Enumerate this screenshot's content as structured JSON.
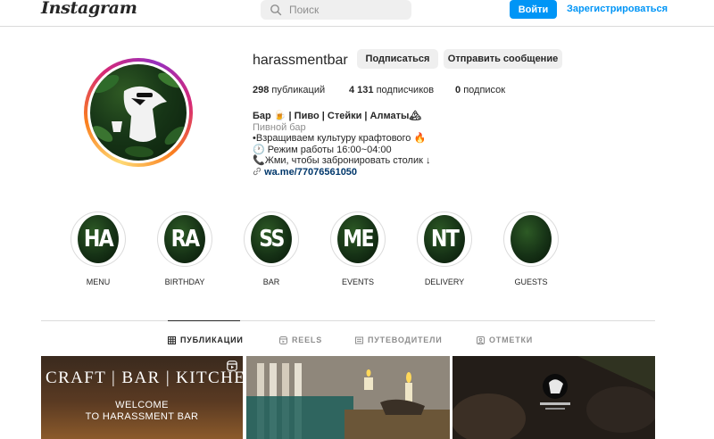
{
  "header": {
    "logo": "Instagram",
    "search_placeholder": "Поиск",
    "login_label": "Войти",
    "register_label": "Зарегистрироваться",
    "accent_color": "#0095f6"
  },
  "profile": {
    "username": "harassmentbar",
    "follow_label": "Подписаться",
    "message_label": "Отправить сообщение",
    "posts_count": "298",
    "posts_label": "публикаций",
    "followers_count": "4 131",
    "followers_label": "подписчиков",
    "following_count": "0",
    "following_label": "подписок",
    "bio_name": "Бар 🍺 | Пиво | Стейки | Алматы🏔",
    "bio_category": "Пивной бар",
    "bio_line1": "•Взращиваем культуру крафтового 🔥",
    "bio_line2": "🕐 Режим работы 16:00~04:00",
    "bio_line3": "📞Жми, чтобы забронировать столик ↓",
    "bio_link": "wa.me/77076561050"
  },
  "highlights": [
    {
      "label": "MENU",
      "letters": "HA"
    },
    {
      "label": "BIRTHDAY",
      "letters": "RA"
    },
    {
      "label": "BAR",
      "letters": "SS"
    },
    {
      "label": "EVENTS",
      "letters": "ME"
    },
    {
      "label": "DELIVERY",
      "letters": "NT"
    },
    {
      "label": "GUESTS",
      "letters": ""
    }
  ],
  "tabs": [
    {
      "label": "ПУБЛИКАЦИИ",
      "icon": "grid-icon",
      "active": true
    },
    {
      "label": "REELS",
      "icon": "reels-icon",
      "active": false
    },
    {
      "label": "ПУТЕВОДИТЕЛИ",
      "icon": "guide-icon",
      "active": false
    },
    {
      "label": "ОТМЕТКИ",
      "icon": "tag-icon",
      "active": false
    }
  ],
  "posts": [
    {
      "title": "CRAFT | BAR | KITCHEN",
      "caption_line1": "WELCOME",
      "caption_line2": "TO HARASSMENT BAR",
      "icon": "reels-icon"
    },
    {
      "title": "",
      "icon": ""
    },
    {
      "title": "",
      "icon": ""
    }
  ]
}
